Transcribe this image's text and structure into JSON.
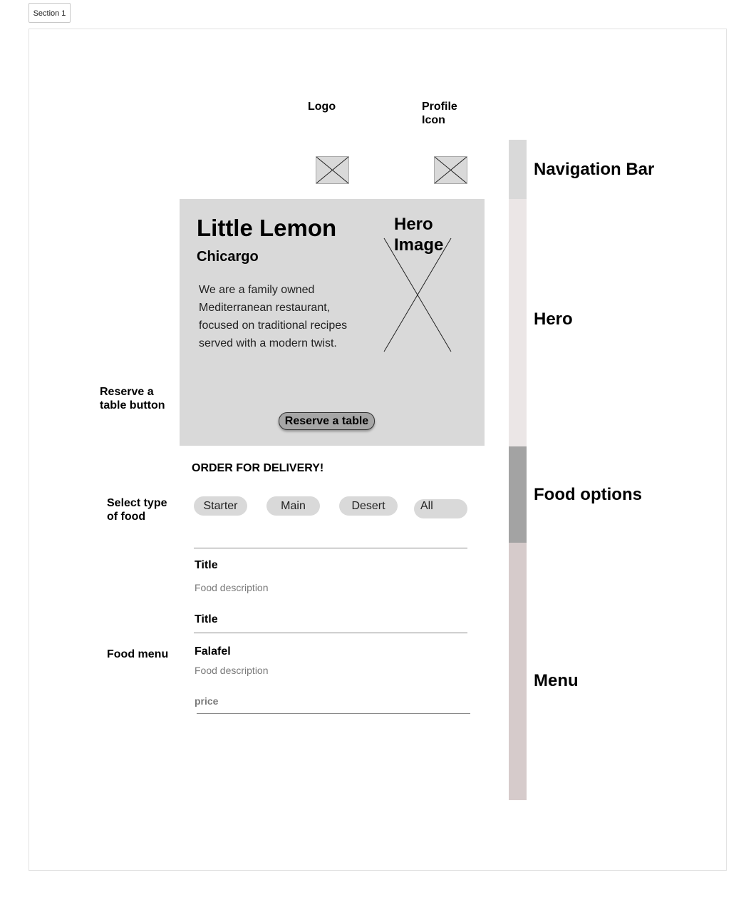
{
  "canvas": {
    "section_tab": "Section 1"
  },
  "annotations": {
    "logo": "Logo",
    "profile_icon": "Profile Icon",
    "reserve_button": "Reserve a table button",
    "select_type": "Select type of food",
    "food_menu": "Food menu"
  },
  "hero": {
    "title": "Little Lemon",
    "subtitle": "Chicargo",
    "description": "We are a family owned Mediterranean restaurant, focused on traditional recipes served with a modern twist.",
    "image_label": "Hero Image",
    "reserve_label": "Reserve a table"
  },
  "order": {
    "heading": "ORDER FOR DELIVERY!",
    "filters": [
      "Starter",
      "Main",
      "Desert",
      "All"
    ]
  },
  "menu": {
    "item1_title": "Title",
    "item1_desc": "Food description",
    "item2_title": "Title",
    "item3_title": "Falafel",
    "item3_desc": "Food description",
    "item3_price": "price"
  },
  "sections": {
    "navigation": "Navigation Bar",
    "hero": "Hero",
    "food_options": "Food options",
    "menu": "Menu"
  },
  "colors": {
    "nav_bar": "#d9d9d9",
    "hero_bar": "#ebe6e6",
    "food_options_bar": "#a3a3a3",
    "menu_bar": "#d6cbcb",
    "hero_background": "#d9d9d9",
    "button_fill": "#a6a6a6"
  }
}
